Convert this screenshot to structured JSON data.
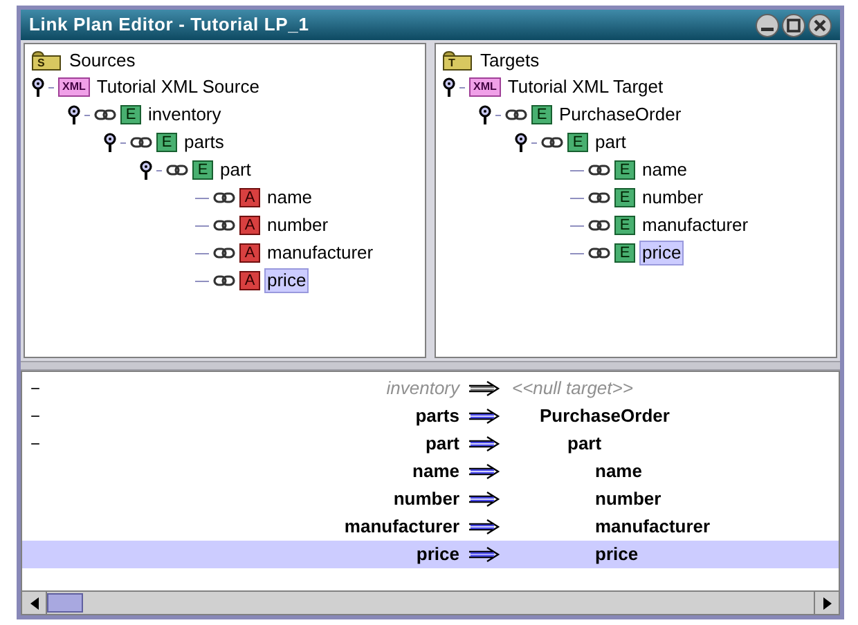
{
  "window": {
    "title": "Link Plan Editor - Tutorial LP_1"
  },
  "sources": {
    "label": "Sources",
    "folder_letter": "S",
    "children": [
      {
        "label": "Tutorial XML Source",
        "kind": "xml",
        "badge": "XML",
        "selected": false,
        "expanded": true,
        "children": [
          {
            "label": "inventory",
            "kind": "element",
            "badge": "E",
            "selected": false,
            "expanded": true,
            "children": [
              {
                "label": "parts",
                "kind": "element",
                "badge": "E",
                "selected": false,
                "expanded": true,
                "children": [
                  {
                    "label": "part",
                    "kind": "element",
                    "badge": "E",
                    "selected": false,
                    "expanded": true,
                    "children": [
                      {
                        "label": "name",
                        "kind": "attribute",
                        "badge": "A",
                        "selected": false
                      },
                      {
                        "label": "number",
                        "kind": "attribute",
                        "badge": "A",
                        "selected": false
                      },
                      {
                        "label": "manufacturer",
                        "kind": "attribute",
                        "badge": "A",
                        "selected": false
                      },
                      {
                        "label": "price",
                        "kind": "attribute",
                        "badge": "A",
                        "selected": true
                      }
                    ]
                  }
                ]
              }
            ]
          }
        ]
      }
    ]
  },
  "targets": {
    "label": "Targets",
    "folder_letter": "T",
    "children": [
      {
        "label": "Tutorial XML Target",
        "kind": "xml",
        "badge": "XML",
        "selected": false,
        "expanded": true,
        "children": [
          {
            "label": "PurchaseOrder",
            "kind": "element",
            "badge": "E",
            "selected": false,
            "expanded": true,
            "children": [
              {
                "label": "part",
                "kind": "element",
                "badge": "E",
                "selected": false,
                "expanded": true,
                "children": [
                  {
                    "label": "name",
                    "kind": "element",
                    "badge": "E",
                    "selected": false
                  },
                  {
                    "label": "number",
                    "kind": "element",
                    "badge": "E",
                    "selected": false
                  },
                  {
                    "label": "manufacturer",
                    "kind": "element",
                    "badge": "E",
                    "selected": false
                  },
                  {
                    "label": "price",
                    "kind": "element",
                    "badge": "E",
                    "selected": true
                  }
                ]
              }
            ]
          }
        ]
      }
    ]
  },
  "mappings": [
    {
      "toggle": "−",
      "source": "inventory",
      "target": "<<null target>>",
      "kind": "null",
      "selected": false,
      "children": [
        {
          "toggle": "−",
          "source": "parts",
          "target": "PurchaseOrder",
          "kind": "mapped",
          "selected": false,
          "children": [
            {
              "toggle": "−",
              "source": "part",
              "target": "part",
              "kind": "mapped",
              "selected": false,
              "children": [
                {
                  "source": "name",
                  "target": "name",
                  "kind": "mapped",
                  "selected": false
                },
                {
                  "source": "number",
                  "target": "number",
                  "kind": "mapped",
                  "selected": false
                },
                {
                  "source": "manufacturer",
                  "target": "manufacturer",
                  "kind": "mapped",
                  "selected": false
                },
                {
                  "source": "price",
                  "target": "price",
                  "kind": "mapped",
                  "selected": true
                }
              ]
            }
          ]
        }
      ]
    }
  ]
}
